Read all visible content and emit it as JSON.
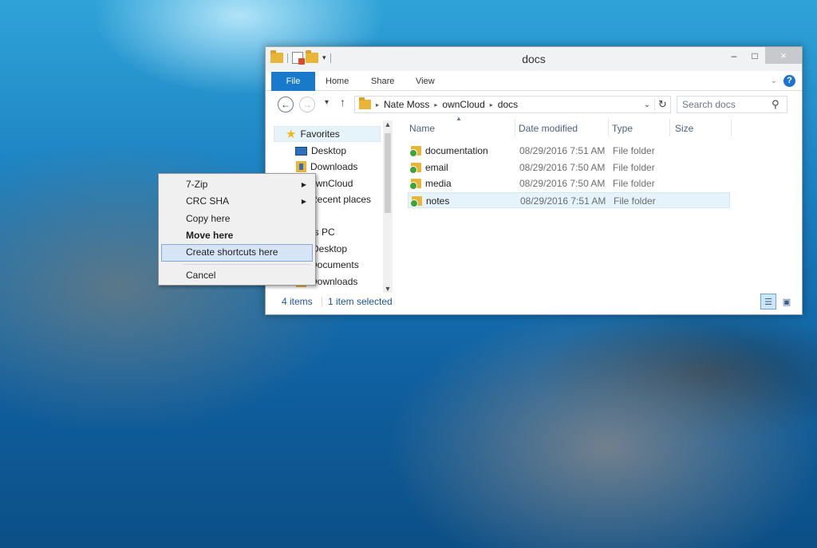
{
  "window": {
    "title": "docs",
    "minimize_glyph": "–",
    "maximize_glyph": "□",
    "close_glyph": "×",
    "qat_dropdown_glyph": "▾"
  },
  "ribbon": {
    "tabs": [
      "File",
      "Home",
      "Share",
      "View"
    ],
    "expand_glyph": "⌄",
    "help_glyph": "?"
  },
  "navigation": {
    "back_glyph": "←",
    "forward_glyph": "→",
    "recent_glyph": "▾",
    "up_glyph": "↑",
    "breadcrumb": [
      "Nate Moss",
      "ownCloud",
      "docs"
    ],
    "crumb_separator": "▸",
    "address_dropdown_glyph": "⌄",
    "refresh_glyph": "↻",
    "search_placeholder": "Search docs",
    "search_glyph": "⚲"
  },
  "nav_pane": {
    "items": [
      "Favorites",
      "Desktop",
      "Downloads",
      "ownCloud",
      "Recent places",
      "This PC",
      "Desktop",
      "Documents",
      "Downloads"
    ],
    "scroll_up": "▲",
    "scroll_down": "▼"
  },
  "file_list": {
    "columns": [
      "Name",
      "Date modified",
      "Type",
      "Size"
    ],
    "sort_glyph": "▲",
    "rows": [
      {
        "name": "documentation",
        "date": "08/29/2016 7:51 AM",
        "type": "File folder"
      },
      {
        "name": "email",
        "date": "08/29/2016 7:50 AM",
        "type": "File folder"
      },
      {
        "name": "media",
        "date": "08/29/2016 7:50 AM",
        "type": "File folder"
      },
      {
        "name": "notes",
        "date": "08/29/2016 7:51 AM",
        "type": "File folder"
      }
    ]
  },
  "status": {
    "items_count": "4 items",
    "selection": "1 item selected",
    "details_glyph": "☰",
    "tiles_glyph": "▣"
  },
  "context_menu": {
    "items": [
      "7-Zip",
      "CRC SHA",
      "Copy here",
      "Move here",
      "Create shortcuts here",
      "Cancel"
    ],
    "submenu_glyph": "▶"
  },
  "colors": {
    "accent": "#1979ca",
    "selection": "#e5f3fb",
    "menu_hover": "#d5e5f5"
  }
}
